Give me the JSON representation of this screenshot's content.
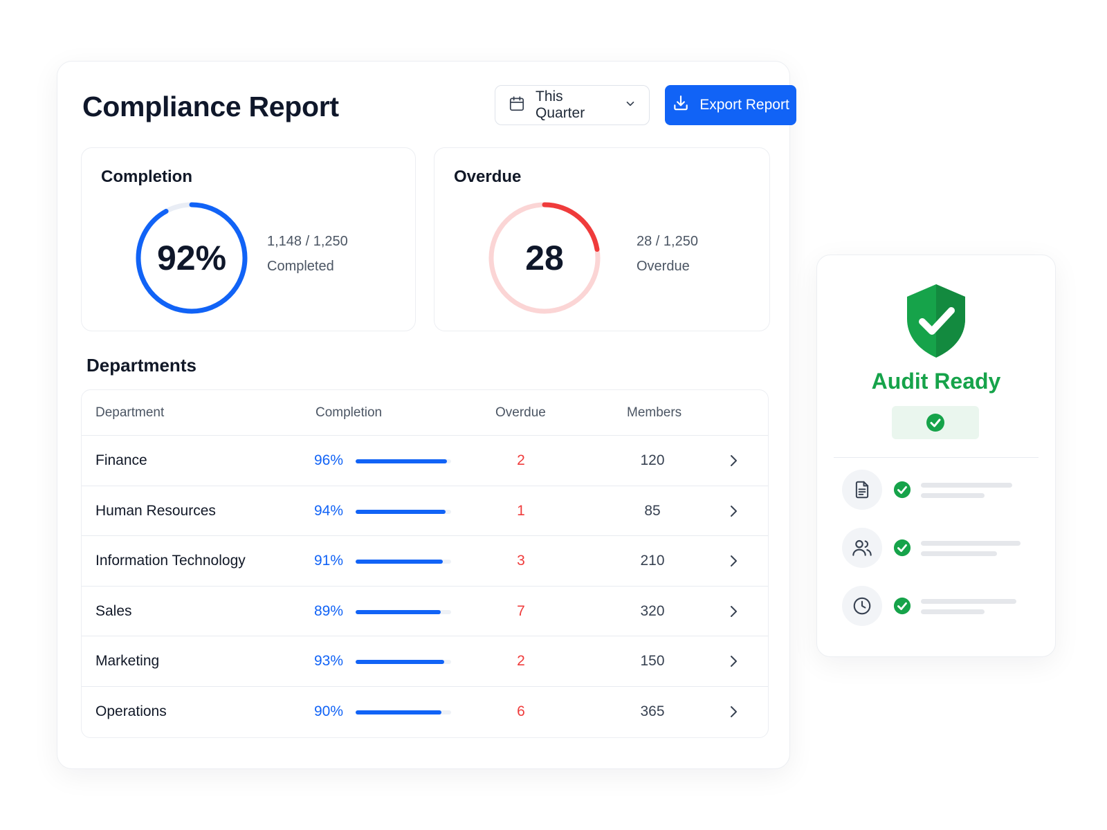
{
  "header": {
    "title": "Compliance Report",
    "period_select": {
      "value": "This Quarter",
      "icon": "calendar-icon"
    },
    "export_button": {
      "label": "Export Report",
      "icon": "download-icon"
    }
  },
  "stats": {
    "completion": {
      "title": "Completion",
      "value": "92%",
      "fraction_complete": 0.92,
      "fraction_text": "1,148 / 1,250",
      "caption": "Completed",
      "color": "#1163f6"
    },
    "overdue": {
      "title": "Overdue",
      "value": "28",
      "fraction_overdue": 0.0224,
      "fraction_text": "28 / 1,250",
      "caption": "Overdue",
      "color": "#ef3b3b"
    }
  },
  "departments": {
    "title": "Departments",
    "columns": [
      "Department",
      "Completion",
      "Overdue",
      "Members"
    ],
    "rows": [
      {
        "name": "Finance",
        "completion": "96%",
        "completion_value": 96,
        "overdue": "2",
        "members": "120"
      },
      {
        "name": "Human Resources",
        "completion": "94%",
        "completion_value": 94,
        "overdue": "1",
        "members": "85"
      },
      {
        "name": "Information Technology",
        "completion": "91%",
        "completion_value": 91,
        "overdue": "3",
        "members": "210"
      },
      {
        "name": "Sales",
        "completion": "89%",
        "completion_value": 89,
        "overdue": "7",
        "members": "320"
      },
      {
        "name": "Marketing",
        "completion": "93%",
        "completion_value": 93,
        "overdue": "2",
        "members": "150"
      },
      {
        "name": "Operations",
        "completion": "90%",
        "completion_value": 90,
        "overdue": "6",
        "members": "365"
      }
    ]
  },
  "audit": {
    "title": "Audit Ready",
    "status_color": "#16a34a",
    "checklist": [
      {
        "icon": "document-icon",
        "status": "check-circle-icon"
      },
      {
        "icon": "users-icon",
        "status": "check-circle-icon"
      },
      {
        "icon": "clock-icon",
        "status": "check-circle-icon"
      }
    ]
  }
}
